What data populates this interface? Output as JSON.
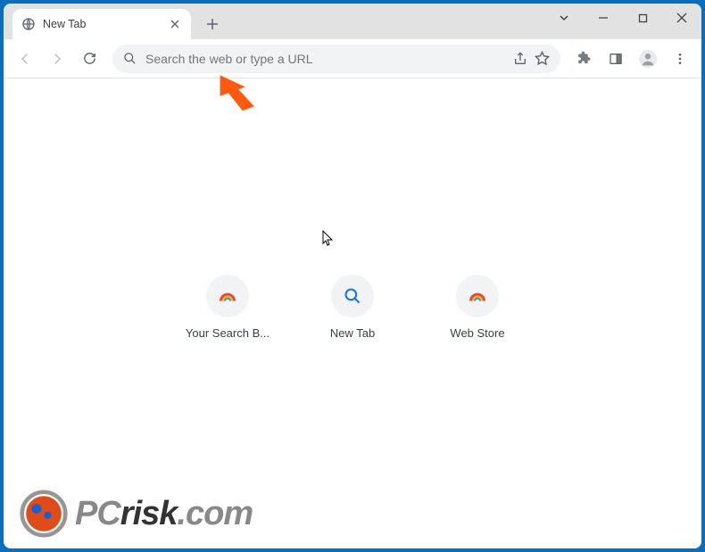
{
  "tab": {
    "title": "New Tab"
  },
  "omnibox": {
    "placeholder": "Search the web or type a URL"
  },
  "shortcuts": [
    {
      "label": "Your Search B...",
      "icon": "rainbow"
    },
    {
      "label": "New Tab",
      "icon": "search"
    },
    {
      "label": "Web Store",
      "icon": "rainbow"
    }
  ],
  "watermark": {
    "pc": "PC",
    "risk": "risk",
    "dotcom": ".com"
  }
}
